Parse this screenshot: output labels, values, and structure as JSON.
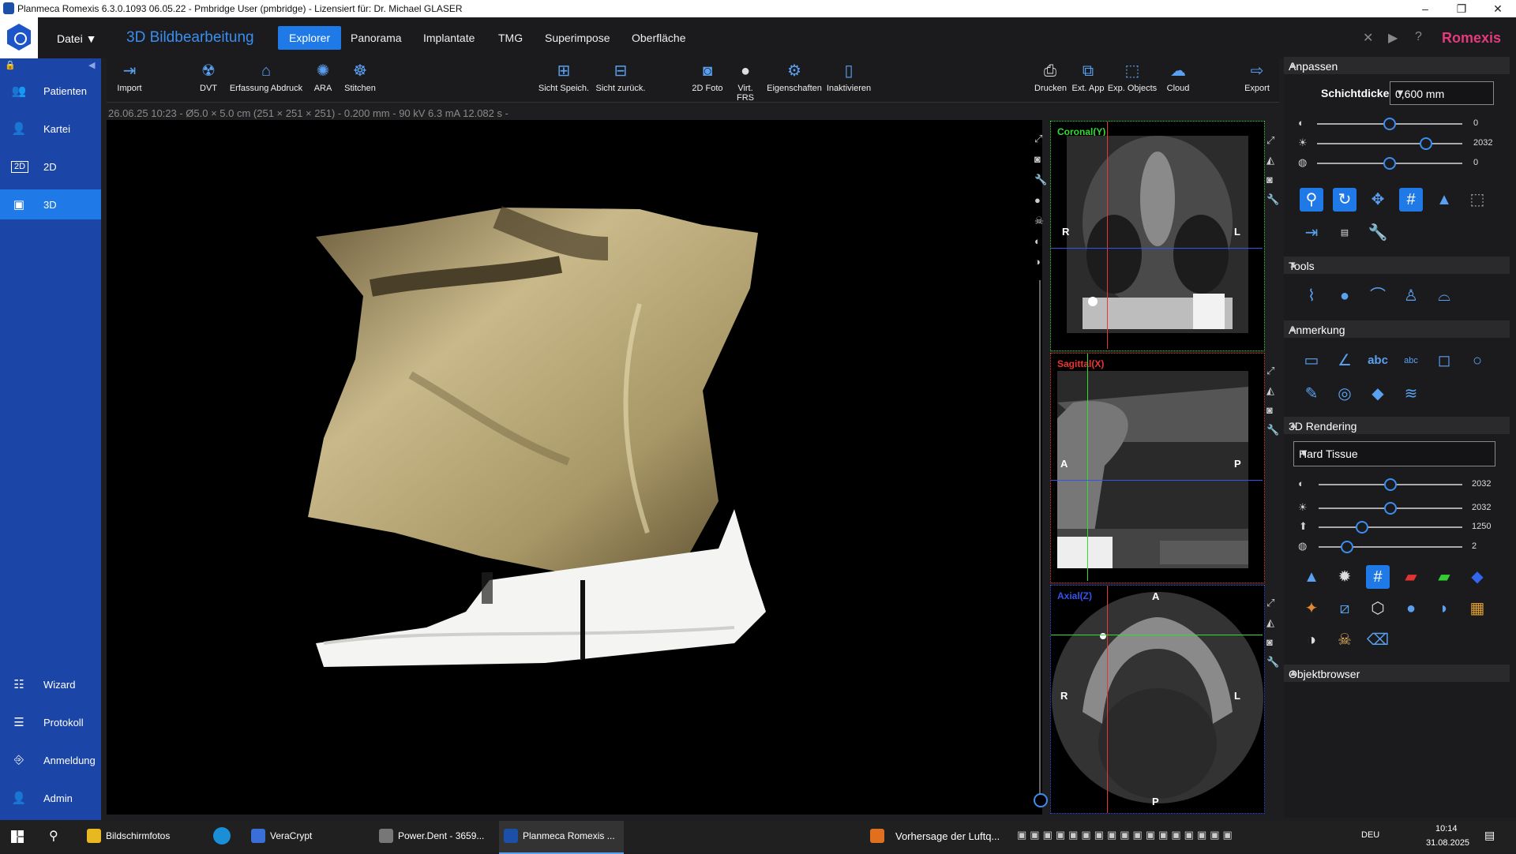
{
  "window": {
    "title": "Planmeca Romexis 6.3.0.1093 06.05.22 - Pmbridge User (pmbridge) - Lizensiert für: Dr. Michael GLASER",
    "minimize": "–",
    "maximize": "❐",
    "close": "✕"
  },
  "nav": {
    "file_menu": "Datei",
    "module_title": "3D Bildbearbeitung",
    "tabs": [
      {
        "label": "Explorer",
        "active": true
      },
      {
        "label": "Panorama"
      },
      {
        "label": "Implantate"
      },
      {
        "label": "TMG"
      },
      {
        "label": "Superimpose"
      },
      {
        "label": "Oberfläche"
      }
    ],
    "brand": "Romexis",
    "brand_color": "#e23a7e"
  },
  "sidebar": {
    "items": [
      {
        "label": "Patienten",
        "icon": "users-icon"
      },
      {
        "label": "Kartei",
        "icon": "user-icon"
      },
      {
        "label": "2D",
        "icon": "2d-icon"
      },
      {
        "label": "3D",
        "icon": "3d-icon",
        "active": true
      }
    ],
    "bottom": [
      {
        "label": "Wizard",
        "icon": "wizard-icon"
      },
      {
        "label": "Protokoll",
        "icon": "protocol-icon"
      },
      {
        "label": "Anmeldung",
        "icon": "login-icon"
      },
      {
        "label": "Admin",
        "icon": "admin-icon"
      }
    ]
  },
  "toolbar": {
    "left": [
      "Import",
      "DVT",
      "Erfassung Abdruck",
      "ARA",
      "Stitchen"
    ],
    "center": [
      "Sicht Speich.",
      "Sicht zurück.",
      "2D Foto",
      "Virt. FRS",
      "Eigenschaften",
      "Inaktivieren"
    ],
    "right": [
      "Drucken",
      "Ext. App",
      "Exp. Objects",
      "Cloud",
      "Export"
    ]
  },
  "scan_info": "26.06.25 10:23 - Ø5.0 × 5.0 cm (251 × 251 × 251) - 0.200 mm - 90 kV 6.3 mA 12.082 s -",
  "views": {
    "coronal": {
      "label": "Coronal(Y)",
      "color": "#33dd33",
      "left": "R",
      "right": "L"
    },
    "sagittal": {
      "label": "Sagittal(X)",
      "color": "#ee3333",
      "left": "A",
      "right": "P"
    },
    "axial": {
      "label": "Axial(Z)",
      "color": "#3355ee",
      "left": "R",
      "right": "L",
      "top": "A",
      "bottom": "P"
    }
  },
  "panel": {
    "anpassen": {
      "title": "Anpassen",
      "slice_label": "Schichtdicke",
      "slice_value": "0,600 mm",
      "sliders": [
        {
          "value": "0",
          "level": 0.5
        },
        {
          "value": "2032",
          "level": 0.75
        },
        {
          "value": "0",
          "level": 0.5
        }
      ]
    },
    "tools_title": "Tools",
    "annotation_title": "Anmerkung",
    "annotation_abc": "abc",
    "rendering": {
      "title": "3D Rendering",
      "preset": "Hard Tissue",
      "sliders": [
        {
          "value": "2032",
          "level": 0.5
        },
        {
          "value": "2032",
          "level": 0.5
        },
        {
          "value": "1250",
          "level": 0.3
        },
        {
          "value": "2",
          "level": 0.2
        }
      ]
    },
    "objects_title": "Objektbrowser"
  },
  "taskbar": {
    "apps": [
      {
        "label": "Bildschirmfotos"
      },
      {
        "label": "VeraCrypt"
      },
      {
        "label": "Power.Dent  -  3659..."
      },
      {
        "label": "Planmeca Romexis ...",
        "active": true
      }
    ],
    "weather": "Vorhersage der Luftq...",
    "lang": "DEU",
    "time": "10:14",
    "date": "31.08.2025"
  }
}
